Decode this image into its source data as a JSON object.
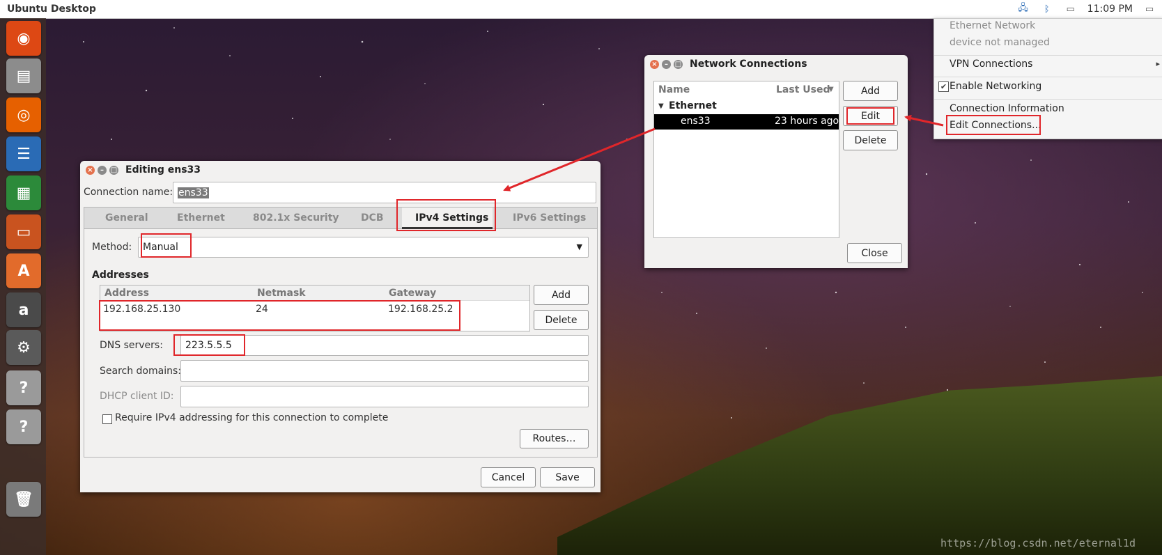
{
  "topbar": {
    "title": "Ubuntu Desktop",
    "clock": "11:09 PM",
    "tray_icons": [
      "network-icon",
      "bluetooth-icon",
      "keyboard-icon",
      "battery-icon"
    ]
  },
  "launcher": {
    "items": [
      {
        "name": "ubuntu-dash-icon",
        "glyph": "◉",
        "color": "#dd4814"
      },
      {
        "name": "files-icon",
        "glyph": "▤",
        "color": "#8c8c8c"
      },
      {
        "name": "firefox-icon",
        "glyph": "◎",
        "color": "#e66000"
      },
      {
        "name": "libreoffice-writer-icon",
        "glyph": "☰",
        "color": "#2a6bb5"
      },
      {
        "name": "libreoffice-calc-icon",
        "glyph": "▦",
        "color": "#2c8a3a"
      },
      {
        "name": "libreoffice-impress-icon",
        "glyph": "▭",
        "color": "#c9531f"
      },
      {
        "name": "software-center-icon",
        "glyph": "A",
        "color": "#e26b2b"
      },
      {
        "name": "amazon-icon",
        "glyph": "a",
        "color": "#4a4a4a"
      },
      {
        "name": "system-settings-icon",
        "glyph": "⚙",
        "color": "#5a5a5a"
      },
      {
        "name": "unknown-app-icon",
        "glyph": "?",
        "color": "#9a9a9a"
      },
      {
        "name": "unknown-app-icon",
        "glyph": "?",
        "color": "#9a9a9a"
      },
      {
        "name": "trash-icon",
        "glyph": "🗑",
        "color": "#7a7a7a"
      }
    ]
  },
  "network_menu": {
    "status_title": "Ethernet Network",
    "status_sub": "device not managed",
    "vpn": "VPN Connections",
    "enable_networking": "Enable Networking",
    "connection_info": "Connection Information",
    "edit_connections": "Edit Connections..."
  },
  "network_connections": {
    "title": "Network Connections",
    "col_name": "Name",
    "col_last_used": "Last Used",
    "group": "Ethernet",
    "row_name": "ens33",
    "row_last_used": "23 hours ago",
    "add": "Add",
    "edit": "Edit",
    "delete": "Delete",
    "close": "Close"
  },
  "editor": {
    "title": "Editing ens33",
    "connection_name_label": "Connection name:",
    "connection_name": "ens33",
    "tabs": [
      "General",
      "Ethernet",
      "802.1x Security",
      "DCB",
      "IPv4 Settings",
      "IPv6 Settings"
    ],
    "method_label": "Method:",
    "method": "Manual",
    "addresses_heading": "Addresses",
    "col_address": "Address",
    "col_netmask": "Netmask",
    "col_gateway": "Gateway",
    "address": "192.168.25.130",
    "netmask": "24",
    "gateway": "192.168.25.2",
    "add": "Add",
    "delete": "Delete",
    "dns_label": "DNS servers:",
    "dns": "223.5.5.5",
    "search_label": "Search domains:",
    "dhcp_label": "DHCP client ID:",
    "require_label": "Require IPv4 addressing for this connection to complete",
    "routes": "Routes…",
    "cancel": "Cancel",
    "save": "Save"
  },
  "watermark": "https://blog.csdn.net/eternal1d",
  "colors": {
    "highlight": "#e0262a",
    "selection": "#000000",
    "accent": "#dd4814"
  }
}
